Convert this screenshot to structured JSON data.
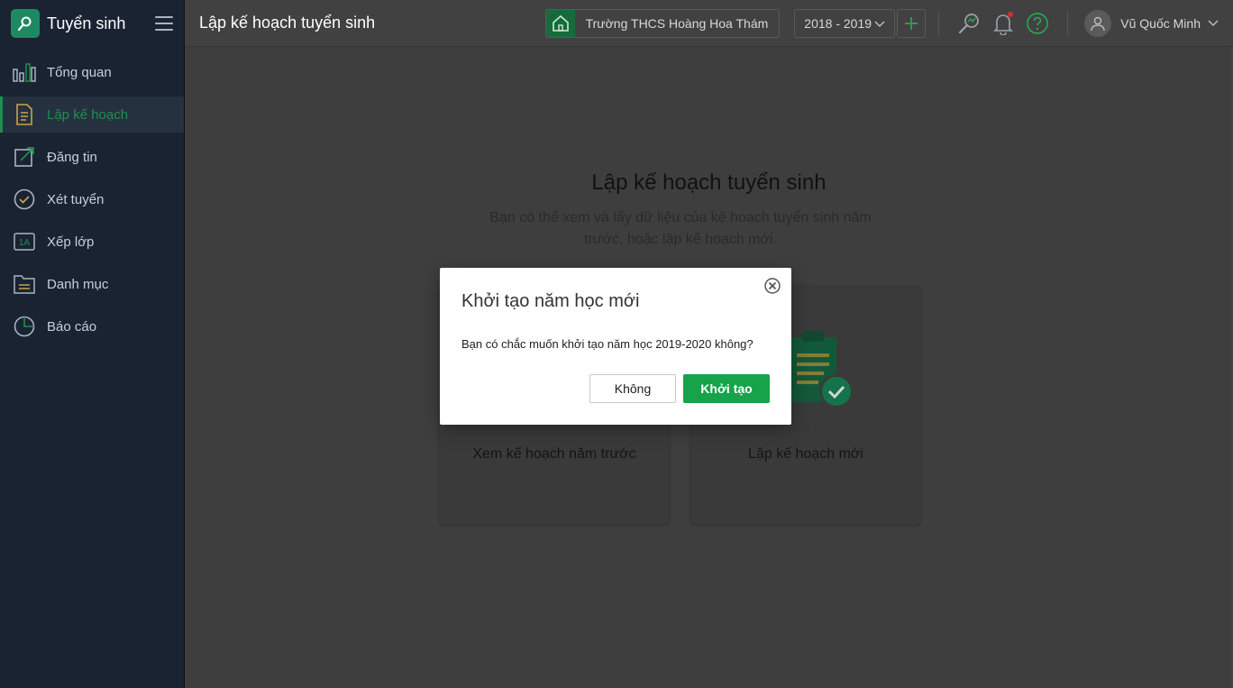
{
  "app": {
    "name": "Tuyển sinh"
  },
  "sidebar": {
    "items": [
      {
        "label": "Tổng quan",
        "icon": "bar-chart-icon",
        "active": false
      },
      {
        "label": "Lập kế hoạch",
        "icon": "document-icon",
        "active": true
      },
      {
        "label": "Đăng tin",
        "icon": "edit-icon",
        "active": false
      },
      {
        "label": "Xét tuyển",
        "icon": "check-circle-icon",
        "active": false
      },
      {
        "label": "Xếp lớp",
        "icon": "class-1a-icon",
        "active": false
      },
      {
        "label": "Danh mục",
        "icon": "folder-icon",
        "active": false
      },
      {
        "label": "Báo cáo",
        "icon": "pie-chart-icon",
        "active": false
      }
    ]
  },
  "header": {
    "title": "Lập kế hoạch tuyển sinh",
    "school": "Trường THCS Hoàng Hoa Thám",
    "year": "2018 - 2019",
    "user": "Vũ Quốc Minh"
  },
  "main": {
    "title": "Lập kế hoạch tuyển sinh",
    "subtitle": "Bạn có thể xem và lấy dữ liệu của kế hoạch tuyển sinh năm trước, hoặc lập kế hoạch mới.",
    "cards": [
      {
        "label": "Xem kế hoạch năm trước"
      },
      {
        "label": "Lập kế hoạch mới"
      }
    ]
  },
  "modal": {
    "title": "Khởi tạo năm học mới",
    "message": "Bạn có chắc muốn khởi tạo năm học 2019-2020 không?",
    "cancel_label": "Không",
    "confirm_label": "Khởi tạo"
  },
  "colors": {
    "accent": "#16a34a",
    "sidebar_bg": "#1a2332",
    "overlay": "#3e3e3e"
  }
}
